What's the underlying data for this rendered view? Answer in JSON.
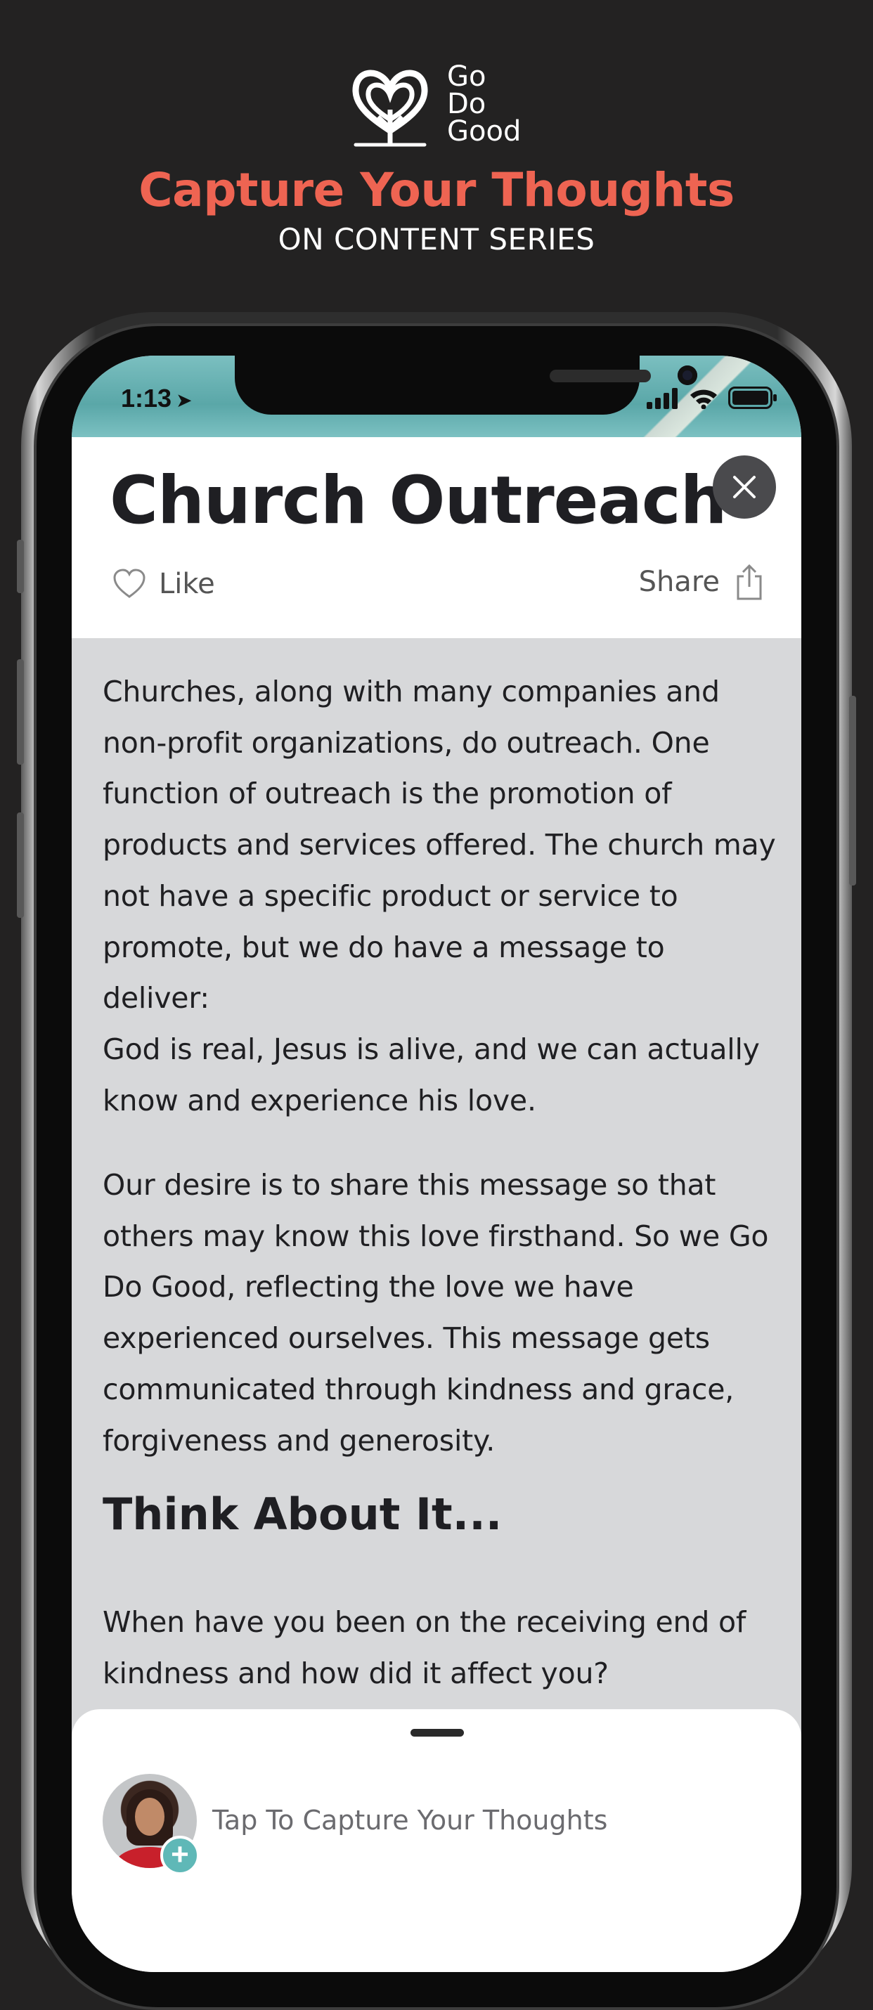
{
  "brand": {
    "name_lines": [
      "Go",
      "Do",
      "Good"
    ]
  },
  "promo": {
    "headline": "Capture Your Thoughts",
    "subhead": "ON CONTENT SERIES",
    "headline_color": "#ee6452"
  },
  "status_bar": {
    "time": "1:13",
    "location_icon": "location-arrow-icon"
  },
  "article": {
    "title": "Church Outreach",
    "like_label": "Like",
    "share_label": "Share",
    "paragraph_1_lines": [
      "Churches, along with many companies and",
      "non-profit organizations, do outreach. One",
      "function of outreach is the promotion of",
      "products and services offered. The church may",
      "not have a specific product or service to",
      "promote, but we do have a message to deliver:",
      "God is real, Jesus is alive, and we can actually",
      "know and experience his love."
    ],
    "paragraph_2_lines": [
      "Our desire is to share this message so that",
      "others may know this love firsthand. So we Go",
      "Do Good, reflecting the love we have",
      "experienced ourselves. This message gets",
      "communicated through kindness and grace,",
      "forgiveness and generosity."
    ],
    "section_heading": "Think About It...",
    "paragraph_3_lines": [
      "When have you been on the receiving end of",
      "kindness and how did it affect you?"
    ]
  },
  "bottom_sheet": {
    "prompt": "Tap To Capture Your Thoughts",
    "accent": "#5fb8b7"
  }
}
